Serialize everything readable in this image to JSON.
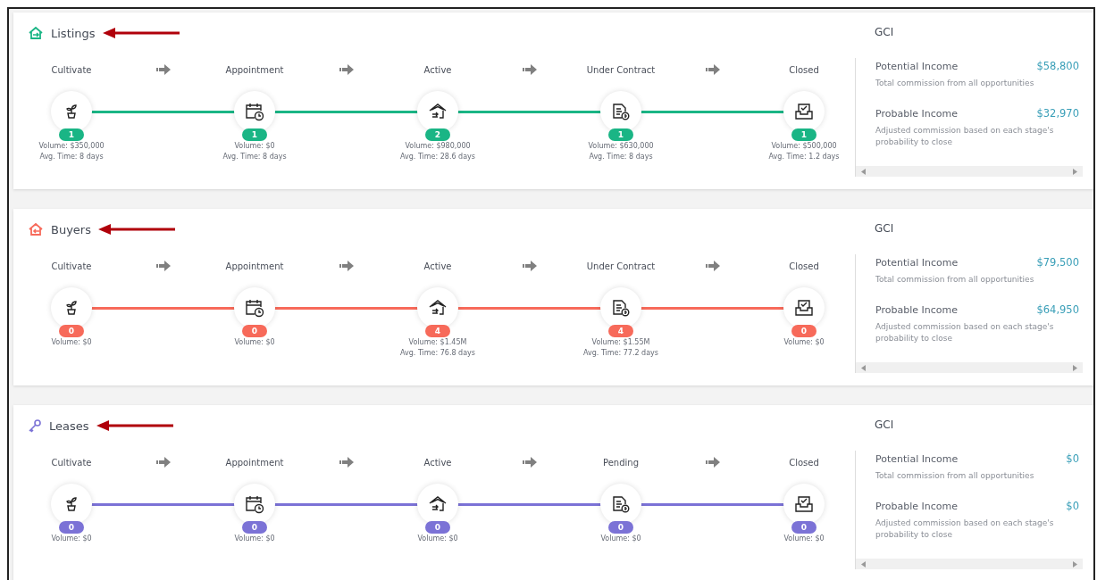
{
  "sections": [
    {
      "title": "Listings",
      "kind": "house-out",
      "color": "#1ab585",
      "stages": [
        {
          "label": "Cultivate",
          "kind": "plant",
          "count": "1",
          "details": [
            "Volume: $350,000",
            "Avg. Time: 8 days"
          ]
        },
        {
          "label": "Appointment",
          "kind": "calendar",
          "count": "1",
          "details": [
            "Volume: $0",
            "Avg. Time: 8 days"
          ]
        },
        {
          "label": "Active",
          "kind": "house",
          "count": "2",
          "details": [
            "Volume: $980,000",
            "Avg. Time: 28.6 days"
          ]
        },
        {
          "label": "Under Contract",
          "kind": "document",
          "count": "1",
          "details": [
            "Volume: $630,000",
            "Avg. Time: 8 days"
          ]
        },
        {
          "label": "Closed",
          "kind": "inbox",
          "count": "1",
          "details": [
            "Volume: $500,000",
            "Avg. Time: 1.2 days"
          ]
        }
      ],
      "gci": {
        "title": "GCI",
        "items": [
          {
            "label": "Potential Income",
            "value": "$58,800",
            "description": "Total commission from all opportunities"
          },
          {
            "label": "Probable Income",
            "value": "$32,970",
            "description": "Adjusted commission based on each stage's probability to close"
          }
        ]
      }
    },
    {
      "title": "Buyers",
      "kind": "house-in",
      "color": "#f76a5a",
      "stages": [
        {
          "label": "Cultivate",
          "kind": "plant",
          "count": "0",
          "details": [
            "Volume: $0"
          ]
        },
        {
          "label": "Appointment",
          "kind": "calendar",
          "count": "0",
          "details": [
            "Volume: $0"
          ]
        },
        {
          "label": "Active",
          "kind": "house",
          "count": "4",
          "details": [
            "Volume: $1.45M",
            "Avg. Time: 76.8 days"
          ]
        },
        {
          "label": "Under Contract",
          "kind": "document",
          "count": "4",
          "details": [
            "Volume: $1.55M",
            "Avg. Time: 77.2 days"
          ]
        },
        {
          "label": "Closed",
          "kind": "inbox",
          "count": "0",
          "details": [
            "Volume: $0"
          ]
        }
      ],
      "gci": {
        "title": "GCI",
        "items": [
          {
            "label": "Potential Income",
            "value": "$79,500",
            "description": "Total commission from all opportunities"
          },
          {
            "label": "Probable Income",
            "value": "$64,950",
            "description": "Adjusted commission based on each stage's probability to close"
          }
        ]
      }
    },
    {
      "title": "Leases",
      "kind": "key",
      "color": "#7b72d6",
      "stages": [
        {
          "label": "Cultivate",
          "kind": "plant",
          "count": "0",
          "details": [
            "Volume: $0"
          ]
        },
        {
          "label": "Appointment",
          "kind": "calendar",
          "count": "0",
          "details": [
            "Volume: $0"
          ]
        },
        {
          "label": "Active",
          "kind": "house",
          "count": "0",
          "details": [
            "Volume: $0"
          ]
        },
        {
          "label": "Pending",
          "kind": "document",
          "count": "0",
          "details": [
            "Volume: $0"
          ]
        },
        {
          "label": "Closed",
          "kind": "inbox",
          "count": "0",
          "details": [
            "Volume: $0"
          ]
        }
      ],
      "gci": {
        "title": "GCI",
        "items": [
          {
            "label": "Potential Income",
            "value": "$0",
            "description": "Total commission from all opportunities"
          },
          {
            "label": "Probable Income",
            "value": "$0",
            "description": "Adjusted commission based on each stage's probability to close"
          }
        ]
      }
    }
  ]
}
